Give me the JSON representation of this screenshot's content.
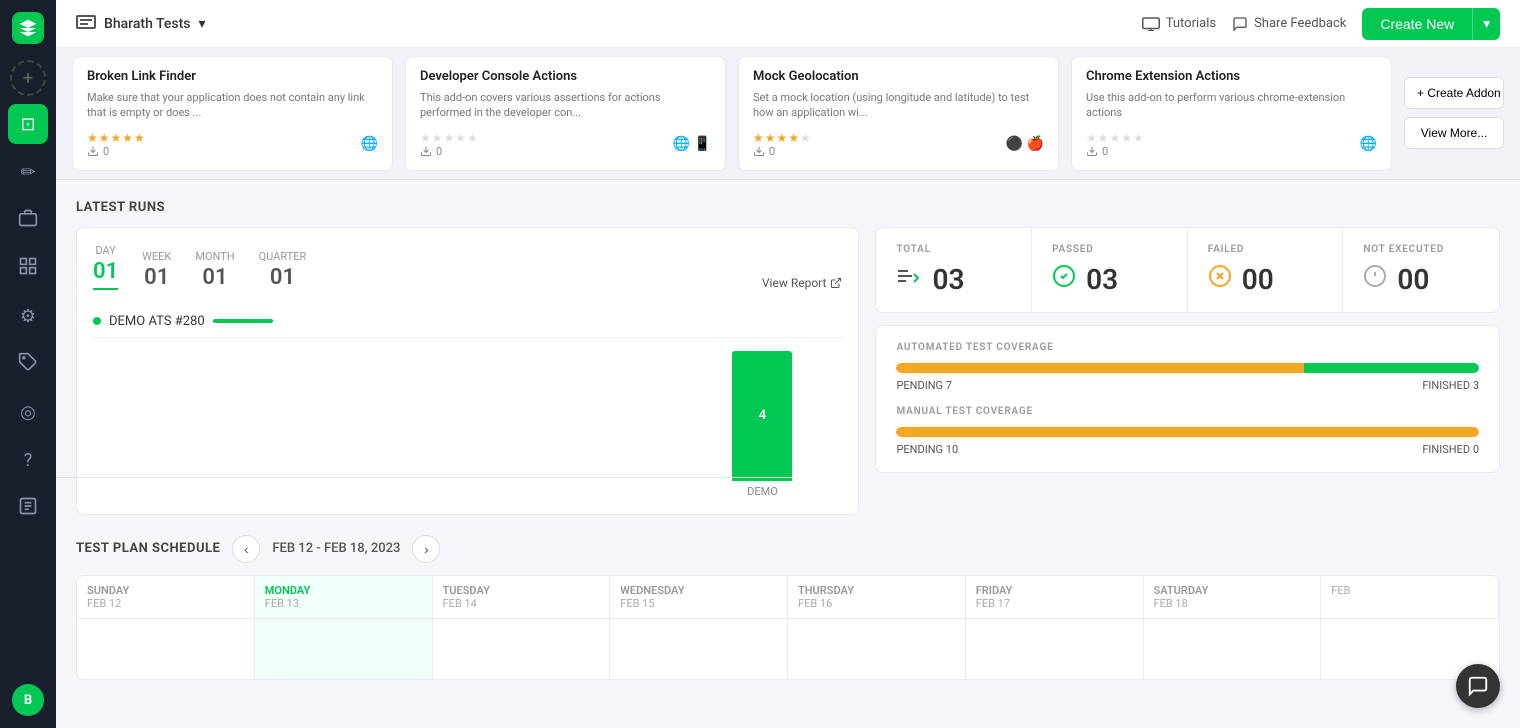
{
  "sidebar": {
    "logo_letter": "",
    "items": [
      {
        "name": "add",
        "icon": "+",
        "active": false
      },
      {
        "name": "dashboard",
        "icon": "⊡",
        "active": true
      },
      {
        "name": "edit",
        "icon": "✏",
        "active": false
      },
      {
        "name": "briefcase",
        "icon": "💼",
        "active": false
      },
      {
        "name": "grid",
        "icon": "⊞",
        "active": false
      },
      {
        "name": "settings",
        "icon": "⚙",
        "active": false
      },
      {
        "name": "puzzle",
        "icon": "🧩",
        "active": false
      },
      {
        "name": "circle",
        "icon": "◎",
        "active": false
      },
      {
        "name": "help",
        "icon": "?",
        "active": false
      },
      {
        "name": "calendar",
        "icon": "📋",
        "active": false
      }
    ],
    "avatar": "B"
  },
  "header": {
    "project_icon": "▤",
    "project_name": "Bharath Tests",
    "dropdown_icon": "▾",
    "tutorials_label": "Tutorials",
    "feedback_label": "Share Feedback",
    "create_new_label": "Create New",
    "create_dropdown_icon": "▾"
  },
  "addons": {
    "items": [
      {
        "title": "Broken Link Finder",
        "description": "Make sure that your application does not contain any link that is empty or does ...",
        "stars_filled": 5,
        "stars_total": 5,
        "downloads": 0,
        "platform_icons": "🌐"
      },
      {
        "title": "Developer Console Actions",
        "description": "This add-on covers various assertions for actions performed in the developer con...",
        "stars_filled": 0,
        "stars_total": 5,
        "downloads": 0,
        "platform_icons": "🌐 📱"
      },
      {
        "title": "Mock Geolocation",
        "description": "Set a mock location (using longitude and latitude) to test how an application wi...",
        "stars_filled": 4,
        "stars_total": 5,
        "downloads": 0,
        "platform_icons": "⚫ 🍎"
      },
      {
        "title": "Chrome Extension Actions",
        "description": "Use this add-on to perform various chrome-extension actions",
        "stars_filled": 0,
        "stars_total": 5,
        "downloads": 0,
        "platform_icons": "🌐"
      }
    ],
    "create_addon_label": "+ Create Addon",
    "view_more_label": "View More..."
  },
  "latest_runs": {
    "section_title": "LATEST RUNS",
    "tabs": [
      {
        "label": "DAY",
        "value": "01",
        "active": true
      },
      {
        "label": "WEEK",
        "value": "01",
        "active": false
      },
      {
        "label": "MONTH",
        "value": "01",
        "active": false
      },
      {
        "label": "QUARTER",
        "value": "01",
        "active": false
      }
    ],
    "view_report_label": "View Report",
    "run_item": "DEMO ATS #280",
    "chart_bar_value": "4",
    "chart_bar_label": "DEMO"
  },
  "stats": {
    "total": {
      "label": "TOTAL",
      "value": "03"
    },
    "passed": {
      "label": "PASSED",
      "value": "03"
    },
    "failed": {
      "label": "FAILED",
      "value": "00"
    },
    "not_executed": {
      "label": "NOT EXECUTED",
      "value": "00"
    }
  },
  "coverage": {
    "automated": {
      "title": "AUTOMATED TEST COVERAGE",
      "pending_label": "PENDING",
      "pending_value": "7",
      "finished_label": "FINISHED",
      "finished_value": "3",
      "pending_pct": 70,
      "finished_pct": 30
    },
    "manual": {
      "title": "MANUAL TEST COVERAGE",
      "pending_label": "PENDING",
      "pending_value": "10",
      "finished_label": "FINISHED",
      "finished_value": "0",
      "pending_pct": 100,
      "finished_pct": 0
    }
  },
  "schedule": {
    "section_title": "TEST PLAN SCHEDULE",
    "date_range": "FEB 12 - FEB 18, 2023",
    "prev_icon": "‹",
    "next_icon": "›",
    "days": [
      {
        "name": "SUNDAY",
        "date": "FEB 12",
        "today": false
      },
      {
        "name": "MONDAY",
        "date": "FEB 13",
        "today": true
      },
      {
        "name": "TUESDAY",
        "date": "FEB 14",
        "today": false
      },
      {
        "name": "WEDNESDAY",
        "date": "FEB 15",
        "today": false
      },
      {
        "name": "THURSDAY",
        "date": "FEB 16",
        "today": false
      },
      {
        "name": "FRIDAY",
        "date": "FEB 17",
        "today": false
      },
      {
        "name": "SATURDAY",
        "date": "FEB 18",
        "today": false
      },
      {
        "name": "",
        "date": "FEB",
        "today": false
      }
    ]
  }
}
